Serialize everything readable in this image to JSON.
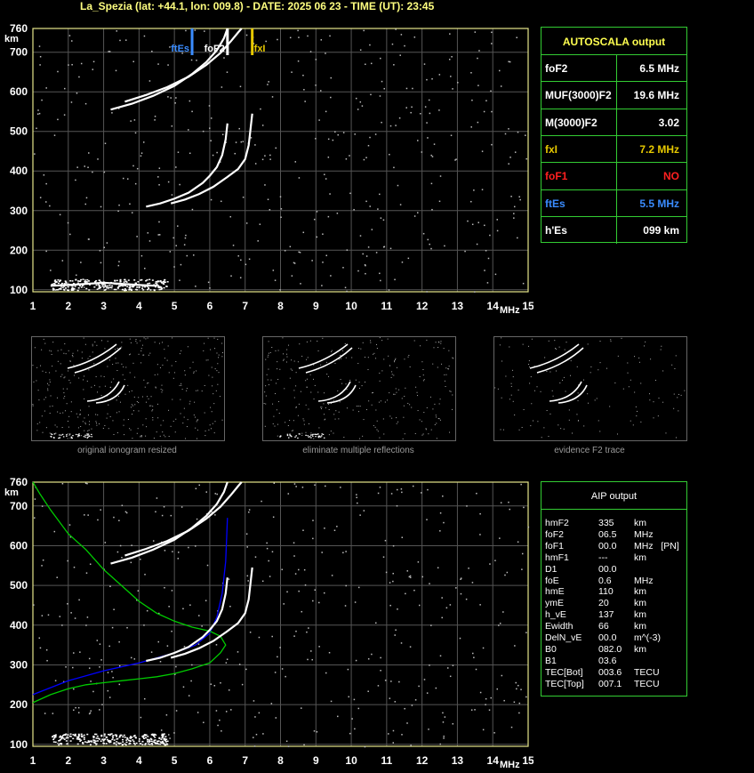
{
  "header": {
    "title": "La_Spezia (lat: +44.1, lon: 009.8) - DATE: 2025 06 23 - TIME (UT): 23:45"
  },
  "autoscala": {
    "title": "AUTOSCALA output",
    "rows": [
      {
        "key": "foF2",
        "value": "6.5 MHz",
        "key_color": "#ffffff",
        "value_color": "#ffffff"
      },
      {
        "key": "MUF(3000)F2",
        "value": "19.6 MHz",
        "key_color": "#ffffff",
        "value_color": "#ffffff"
      },
      {
        "key": "M(3000)F2",
        "value": "3.02",
        "key_color": "#ffffff",
        "value_color": "#ffffff"
      },
      {
        "key": "fxI",
        "value": "7.2 MHz",
        "key_color": "#e6c800",
        "value_color": "#e6c800"
      },
      {
        "key": "foF1",
        "value": "NO",
        "key_color": "#ff2020",
        "value_color": "#ff2020"
      },
      {
        "key": "ftEs",
        "value": "5.5 MHz",
        "key_color": "#3a8cff",
        "value_color": "#3a8cff"
      },
      {
        "key": "h'Es",
        "value": "099     km",
        "key_color": "#ffffff",
        "value_color": "#ffffff"
      }
    ]
  },
  "aip": {
    "title": "AIP output",
    "rows": [
      {
        "k": "hmF2",
        "v": "335",
        "u": "km"
      },
      {
        "k": "foF2",
        "v": "06.5",
        "u": "MHz"
      },
      {
        "k": "foF1",
        "v": "00.0",
        "u": "MHz   [PN]"
      },
      {
        "k": "hmF1",
        "v": "---",
        "u": "km"
      },
      {
        "k": "D1",
        "v": "00.0",
        "u": ""
      },
      {
        "k": "foE",
        "v": "0.6",
        "u": "MHz"
      },
      {
        "k": "hmE",
        "v": "110",
        "u": "km"
      },
      {
        "k": "ymE",
        "v": "20",
        "u": "km"
      },
      {
        "k": "h_vE",
        "v": "137",
        "u": "km"
      },
      {
        "k": "Ewidth",
        "v": "66",
        "u": "km"
      },
      {
        "k": "DelN_vE",
        "v": "00.0",
        "u": "m^(-3)"
      },
      {
        "k": "B0",
        "v": "082.0",
        "u": "km"
      },
      {
        "k": "B1",
        "v": "03.6",
        "u": ""
      },
      {
        "k": "TEC[Bot]",
        "v": "003.6",
        "u": "TECU"
      },
      {
        "k": "TEC[Top]",
        "v": "007.1",
        "u": "TECU"
      }
    ]
  },
  "captions": [
    "original ionogram resized",
    "eliminate multiple reflections",
    "evidence F2 trace"
  ],
  "chart_data": [
    {
      "type": "scatter",
      "name": "ionogram-top",
      "xlabel": "MHz",
      "ylabel": "km",
      "xlim": [
        1,
        15
      ],
      "ylim": [
        95,
        760
      ],
      "x_ticks": [
        1,
        2,
        3,
        4,
        5,
        6,
        7,
        8,
        9,
        10,
        11,
        12,
        13,
        14,
        15
      ],
      "y_ticks": [
        100,
        200,
        300,
        400,
        500,
        600,
        700,
        760
      ],
      "grid": true,
      "markers": [
        {
          "label": "ftEs",
          "x": 5.5,
          "color": "#3a8cff"
        },
        {
          "label": "foF2",
          "x": 6.5,
          "color": "#ffffff"
        },
        {
          "label": "fxI",
          "x": 7.2,
          "color": "#e6c800"
        }
      ],
      "series": [
        {
          "values_x": [
            4.2,
            4.6,
            5.0,
            5.4,
            5.8,
            6.0,
            6.2,
            6.35,
            6.45,
            6.5
          ],
          "values_y": [
            310,
            318,
            330,
            345,
            370,
            388,
            410,
            440,
            480,
            520
          ]
        },
        {
          "values_x": [
            4.9,
            5.3,
            5.7,
            6.1,
            6.5,
            6.8,
            7.0,
            7.1,
            7.15,
            7.2
          ],
          "values_y": [
            318,
            328,
            342,
            360,
            385,
            405,
            430,
            465,
            505,
            545
          ]
        },
        {
          "values_x": [
            3.2,
            3.8,
            4.4,
            5.0,
            5.5,
            5.9,
            6.2,
            6.4,
            6.5
          ],
          "values_y": [
            555,
            570,
            590,
            615,
            645,
            675,
            705,
            735,
            760
          ]
        },
        {
          "values_x": [
            3.6,
            4.2,
            4.8,
            5.4,
            5.9,
            6.3,
            6.6,
            6.8,
            6.9
          ],
          "values_y": [
            575,
            592,
            612,
            638,
            668,
            698,
            728,
            750,
            760
          ]
        },
        {
          "values_x": [
            1.5,
            2.0,
            2.5,
            3.0,
            3.5,
            4.0,
            4.5
          ],
          "values_y": [
            110,
            112,
            115,
            118,
            115,
            112,
            110
          ]
        }
      ]
    },
    {
      "type": "line",
      "name": "ionogram-aip",
      "xlabel": "MHz",
      "ylabel": "km",
      "xlim": [
        1,
        15
      ],
      "ylim": [
        95,
        760
      ],
      "x_ticks": [
        1,
        2,
        3,
        4,
        5,
        6,
        7,
        8,
        9,
        10,
        11,
        12,
        13,
        14,
        15
      ],
      "y_ticks": [
        100,
        200,
        300,
        400,
        500,
        600,
        700,
        760
      ],
      "grid": true,
      "series": [
        {
          "color": "#0000ff",
          "values_x": [
            1.0,
            2.0,
            3.0,
            4.0,
            5.0,
            5.6,
            6.0,
            6.2,
            6.35,
            6.45,
            6.5
          ],
          "values_y": [
            225,
            260,
            285,
            305,
            330,
            350,
            380,
            420,
            480,
            560,
            670
          ]
        },
        {
          "color": "#00cc00",
          "values_x": [
            1.0,
            1.5,
            2.0,
            2.5,
            3.0,
            3.5,
            4.0,
            4.5,
            5.0,
            5.5,
            6.0,
            6.3,
            6.45,
            6.3,
            6.0,
            5.5,
            5.0,
            4.5,
            4.0,
            3.5,
            3.0,
            2.5,
            2.0,
            1.5,
            1.2,
            1.0
          ],
          "values_y": [
            205,
            225,
            240,
            250,
            255,
            260,
            265,
            270,
            278,
            290,
            305,
            330,
            350,
            372,
            385,
            395,
            410,
            430,
            460,
            500,
            540,
            590,
            630,
            690,
            730,
            760
          ]
        },
        {
          "color": "#ffffff",
          "values_x": [
            4.2,
            4.6,
            5.0,
            5.4,
            5.8,
            6.0,
            6.2,
            6.35,
            6.45,
            6.5
          ],
          "values_y": [
            310,
            318,
            330,
            345,
            370,
            388,
            410,
            440,
            480,
            520
          ]
        },
        {
          "color": "#ffffff",
          "values_x": [
            4.9,
            5.3,
            5.7,
            6.1,
            6.5,
            6.8,
            7.0,
            7.1,
            7.15,
            7.2
          ],
          "values_y": [
            318,
            328,
            342,
            360,
            385,
            405,
            430,
            465,
            505,
            545
          ]
        },
        {
          "color": "#ffffff",
          "values_x": [
            3.2,
            3.8,
            4.4,
            5.0,
            5.5,
            5.9,
            6.2,
            6.4,
            6.5
          ],
          "values_y": [
            555,
            570,
            590,
            615,
            645,
            675,
            705,
            735,
            760
          ]
        },
        {
          "color": "#ffffff",
          "values_x": [
            3.6,
            4.2,
            4.8,
            5.4,
            5.9,
            6.3,
            6.6,
            6.8,
            6.9
          ],
          "values_y": [
            575,
            592,
            612,
            638,
            668,
            698,
            728,
            750,
            760
          ]
        }
      ]
    }
  ]
}
